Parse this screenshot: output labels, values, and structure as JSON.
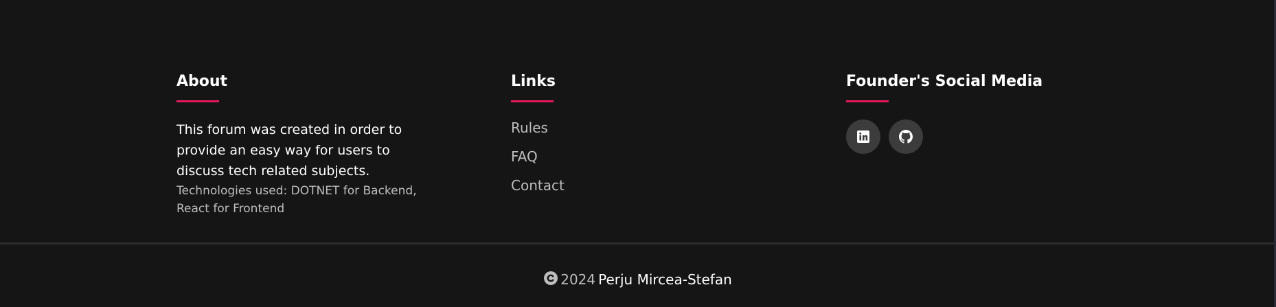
{
  "about": {
    "title": "About",
    "text": "This forum was created in order to provide an easy way for users to discuss tech related subjects.",
    "technologies": "Technologies used: DOTNET for Backend, React for Frontend"
  },
  "links": {
    "title": "Links",
    "items": [
      {
        "label": "Rules"
      },
      {
        "label": "FAQ"
      },
      {
        "label": "Contact"
      }
    ]
  },
  "social": {
    "title": "Founder's Social Media",
    "icons": [
      {
        "icon": "linkedin-icon"
      },
      {
        "icon": "github-icon"
      }
    ]
  },
  "footer": {
    "year": "2024",
    "author": "Perju Mircea-Stefan"
  },
  "colors": {
    "background": "#151515",
    "accent": "#e8195a",
    "icon_button": "#3c3c3c",
    "muted_text": "#bdbdbd"
  }
}
